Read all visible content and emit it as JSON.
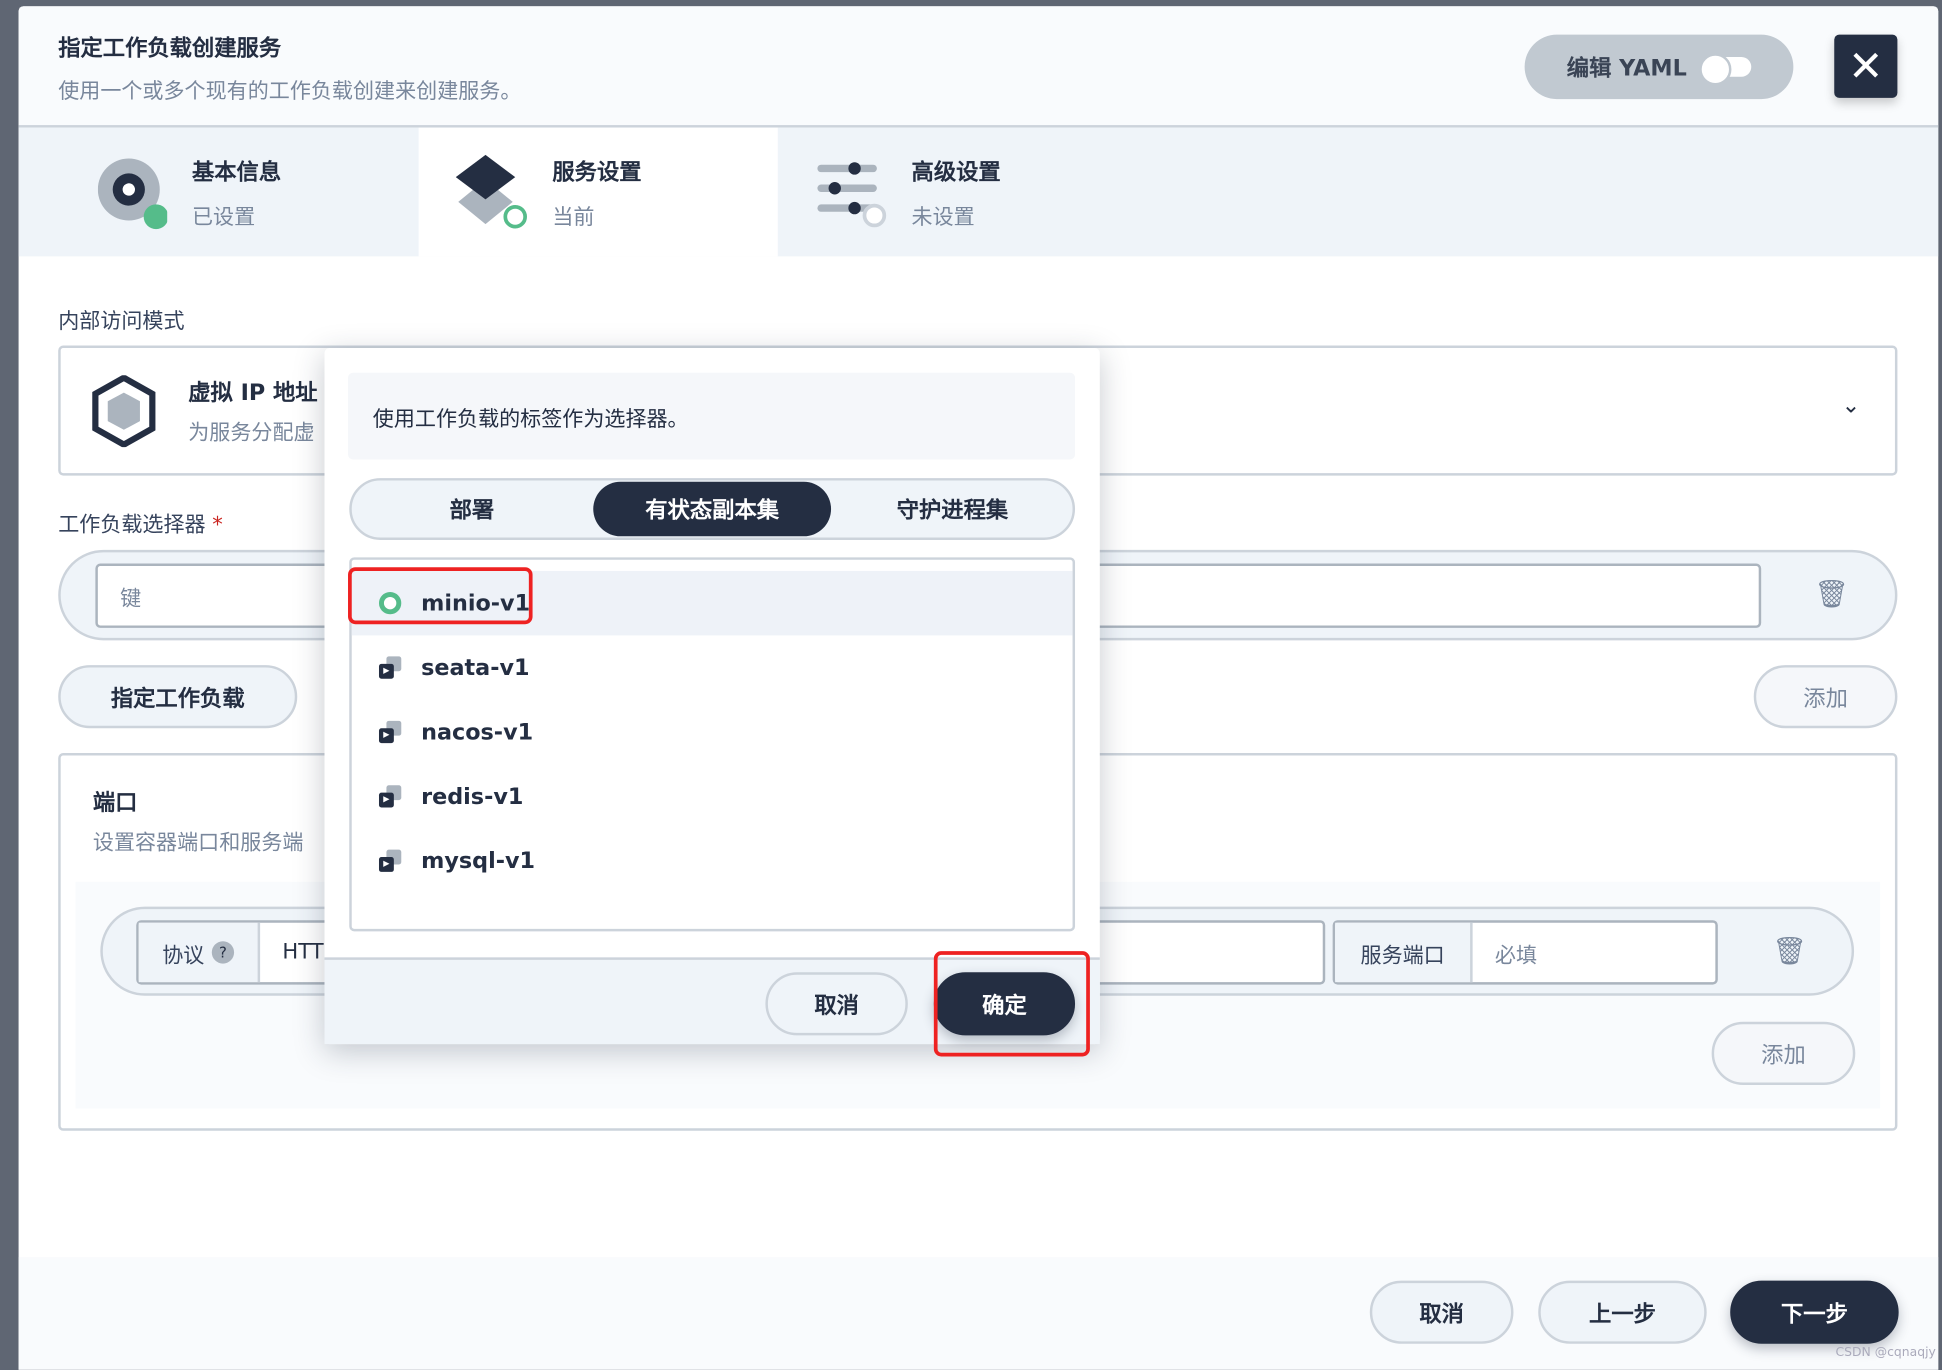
{
  "modal": {
    "title": "指定工作负载创建服务",
    "subtitle": "使用一个或多个现有的工作负载创建来创建服务。",
    "edit_yaml": "编辑 YAML",
    "close_icon": "close-icon"
  },
  "steps": [
    {
      "title": "基本信息",
      "status": "已设置"
    },
    {
      "title": "服务设置",
      "status": "当前"
    },
    {
      "title": "高级设置",
      "status": "未设置"
    }
  ],
  "access": {
    "label": "内部访问模式",
    "mode_title": "虚拟 IP 地址",
    "mode_desc": "为服务分配虚"
  },
  "selector": {
    "label": "工作负载选择器",
    "required": "*",
    "key_placeholder": "键",
    "specify_button": "指定工作负载",
    "add_button": "添加"
  },
  "ports": {
    "title": "端口",
    "desc": "设置容器端口和服务端",
    "protocol_label": "协议",
    "protocol_help": "?",
    "protocol_value": "HTTP",
    "service_port_label": "服务端口",
    "service_port_placeholder": "必填",
    "add_button": "添加"
  },
  "footer": {
    "cancel": "取消",
    "prev": "上一步",
    "next": "下一步"
  },
  "popover": {
    "info": "使用工作负载的标签作为选择器。",
    "tabs": [
      "部署",
      "有状态副本集",
      "守护进程集"
    ],
    "active_tab": 1,
    "workloads": [
      "minio-v1",
      "seata-v1",
      "nacos-v1",
      "redis-v1",
      "mysql-v1"
    ],
    "selected": 0,
    "cancel": "取消",
    "confirm": "确定"
  },
  "colors": {
    "dark": "#242e42",
    "green": "#55bc8a",
    "highlight": "#ee2222"
  },
  "watermark": "CSDN @cqnaqjy"
}
